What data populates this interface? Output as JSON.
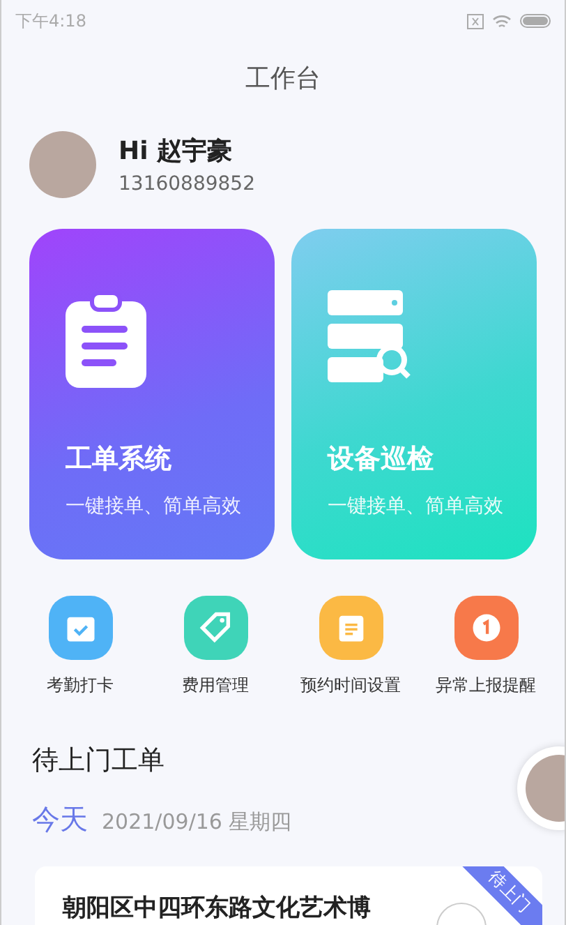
{
  "status_bar": {
    "time": "下午4:18"
  },
  "header": {
    "title": "工作台"
  },
  "profile": {
    "greeting": "Hi 赵宇豪",
    "phone": "13160889852"
  },
  "feature_cards": [
    {
      "kind": "clipboard",
      "title": "工单系统",
      "subtitle": "一键接单、简单高效"
    },
    {
      "kind": "server",
      "title": "设备巡检",
      "subtitle": "一键接单、简单高效"
    }
  ],
  "shortcuts": [
    {
      "kind": "calendar",
      "label": "考勤打卡",
      "color": "#4fb3f6"
    },
    {
      "kind": "tag",
      "label": "费用管理",
      "color": "#3fd4b8"
    },
    {
      "kind": "note",
      "label": "预约时间设置",
      "color": "#fbb944"
    },
    {
      "kind": "alert",
      "label": "异常上报提醒",
      "color": "#f7794a"
    }
  ],
  "pending_orders": {
    "title": "待上门工单",
    "day": "今天",
    "date": "2021/09/16 星期四",
    "orders": [
      {
        "address": "朝阳区中四环东路文化艺术博",
        "status": "待上门"
      }
    ]
  }
}
